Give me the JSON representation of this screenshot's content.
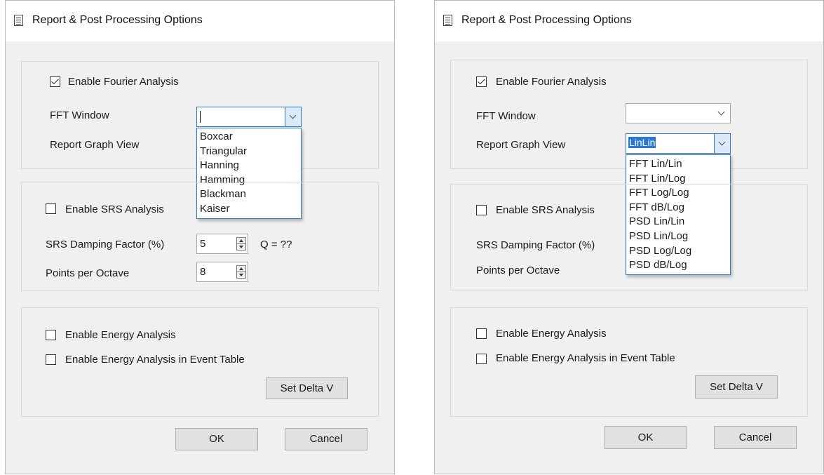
{
  "dialogs": [
    {
      "title": "Report & Post Processing Options",
      "fourier": {
        "enable_label": "Enable Fourier Analysis",
        "enable_checked": true,
        "fft_window_label": "FFT Window",
        "fft_window_value": "",
        "report_graph_view_label": "Report Graph View",
        "report_graph_view_value": ""
      },
      "fft_window_options": [
        "Boxcar",
        "Triangular",
        "Hanning",
        "Hamming",
        "Blackman",
        "Kaiser"
      ],
      "srs": {
        "enable_label": "Enable SRS Analysis",
        "enable_checked": false,
        "damping_label": "SRS Damping Factor (%)",
        "damping_value": "5",
        "q_label": "Q = ??",
        "points_label": "Points per Octave",
        "points_value": "8"
      },
      "energy": {
        "enable_label": "Enable Energy Analysis",
        "enable_event_table_label": "Enable Energy Analysis in Event Table",
        "set_delta_v_label": "Set Delta V"
      },
      "ok_label": "OK",
      "cancel_label": "Cancel"
    },
    {
      "title": "Report & Post Processing Options",
      "fourier": {
        "enable_label": "Enable Fourier Analysis",
        "enable_checked": true,
        "fft_window_label": "FFT Window",
        "fft_window_value": "",
        "report_graph_view_label": "Report Graph View",
        "report_graph_view_value": "LinLin"
      },
      "report_graph_view_options": [
        "FFT Lin/Lin",
        "FFT Lin/Log",
        "FFT Log/Log",
        "FFT dB/Log",
        "PSD Lin/Lin",
        "PSD Lin/Log",
        "PSD Log/Log",
        "PSD dB/Log"
      ],
      "srs": {
        "enable_label": "Enable SRS Analysis",
        "enable_checked": false,
        "damping_label": "SRS Damping Factor (%)",
        "points_label": "Points per Octave"
      },
      "energy": {
        "enable_label": "Enable Energy Analysis",
        "enable_event_table_label": "Enable Energy Analysis in Event Table",
        "set_delta_v_label": "Set Delta V"
      },
      "ok_label": "OK",
      "cancel_label": "Cancel"
    }
  ],
  "colors": {
    "accent": "#2b78d4",
    "dialog_bg": "#f0f0f0",
    "button_bg": "#e1e1e1"
  }
}
